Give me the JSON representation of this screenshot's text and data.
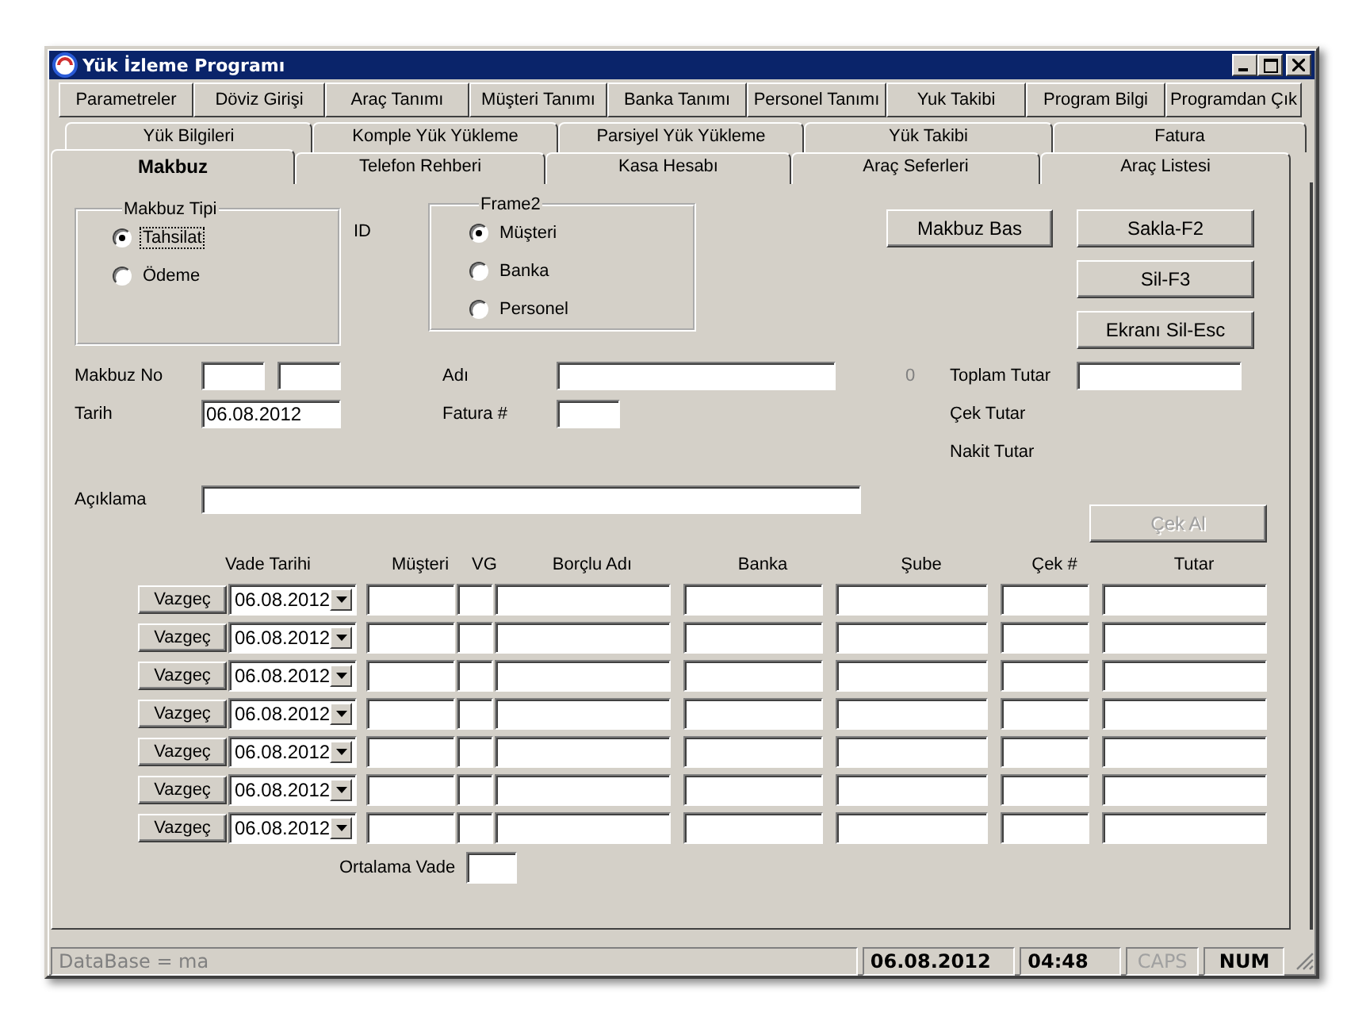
{
  "window": {
    "title": "Yük İzleme Programı"
  },
  "toolbar_buttons": [
    "Parametreler",
    "Döviz Girişi",
    "Araç Tanımı",
    "Müşteri Tanımı",
    "Banka Tanımı",
    "Personel Tanımı",
    "Yuk Takibi",
    "Program Bilgi",
    "Programdan Çık"
  ],
  "tab_rows": [
    {
      "tabs": [
        {
          "label": "Yük Bilgileri",
          "selected": false
        },
        {
          "label": "Komple Yük Yükleme",
          "selected": false
        },
        {
          "label": "Parsiyel Yük Yükleme",
          "selected": false
        },
        {
          "label": "Yük Takibi",
          "selected": false
        },
        {
          "label": "Fatura",
          "selected": false
        }
      ]
    },
    {
      "tabs": [
        {
          "label": "Makbuz",
          "selected": true
        },
        {
          "label": "Telefon Rehberi",
          "selected": false
        },
        {
          "label": "Kasa Hesabı",
          "selected": false
        },
        {
          "label": "Araç Seferleri",
          "selected": false
        },
        {
          "label": "Araç Listesi",
          "selected": false
        }
      ]
    }
  ],
  "makbuz_tipi": {
    "title": "Makbuz Tipi",
    "options": [
      {
        "label": "Tahsilat",
        "selected": true
      },
      {
        "label": "Ödeme",
        "selected": false
      }
    ]
  },
  "id_label": "ID",
  "frame2": {
    "title": "Frame2",
    "options": [
      {
        "label": "Müşteri",
        "selected": true
      },
      {
        "label": "Banka",
        "selected": false
      },
      {
        "label": "Personel",
        "selected": false
      }
    ]
  },
  "makbuz_bas": {
    "label": "Makbuz Bas",
    "disabled": false
  },
  "side_buttons": [
    {
      "label": "Sakla-F2",
      "disabled": false
    },
    {
      "label": "Sil-F3",
      "disabled": false
    },
    {
      "label": "Ekranı Sil-Esc",
      "disabled": false
    }
  ],
  "makbuz_no": {
    "label": "Makbuz No"
  },
  "adi": {
    "label": "Adı"
  },
  "counter": "0",
  "toplam_tutar": {
    "label": "Toplam Tutar"
  },
  "tarih": {
    "label": "Tarih",
    "value": "06.08.2012"
  },
  "fatura": {
    "label": "Fatura #"
  },
  "cek_tutar": {
    "label": "Çek Tutar"
  },
  "nakit_tutar": {
    "label": "Nakit Tutar"
  },
  "aciklama": {
    "label": "Açıklama"
  },
  "cek_al": {
    "label": "Çek Al",
    "disabled": true
  },
  "payments": {
    "columns": [
      "Vade Tarihi",
      "Müşteri",
      "VG",
      "Borçlu Adı",
      "Banka",
      "Şube",
      "Çek #",
      "Tutar"
    ],
    "rows": [
      {
        "cancel": "Vazgeç",
        "date": "06.08.2012"
      },
      {
        "cancel": "Vazgeç",
        "date": "06.08.2012"
      },
      {
        "cancel": "Vazgeç",
        "date": "06.08.2012"
      },
      {
        "cancel": "Vazgeç",
        "date": "06.08.2012"
      },
      {
        "cancel": "Vazgeç",
        "date": "06.08.2012"
      },
      {
        "cancel": "Vazgeç",
        "date": "06.08.2012"
      },
      {
        "cancel": "Vazgeç",
        "date": "06.08.2012"
      }
    ]
  },
  "ortalama_vade": {
    "label": "Ortalama Vade"
  },
  "status_bar": {
    "database": "DataBase = ma",
    "date": "06.08.2012",
    "time": "04:48",
    "indicators": [
      {
        "label": "CAPS",
        "on": false
      },
      {
        "label": "NUM",
        "on": true
      }
    ]
  }
}
